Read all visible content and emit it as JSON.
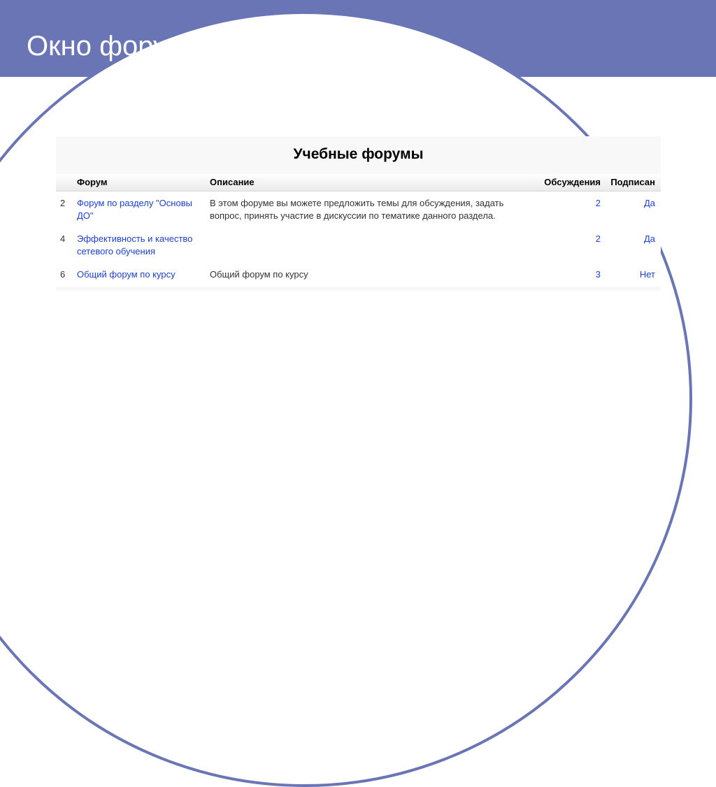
{
  "slide": {
    "title": "Окно форумов на курсе"
  },
  "content": {
    "heading": "Учебные форумы",
    "columns": {
      "n": "",
      "forum": "Форум",
      "desc": "Описание",
      "disc": "Обсуждения",
      "sub": "Подписан"
    },
    "rows": [
      {
        "n": "2",
        "forum": "Форум по разделу \"Основы ДО\"",
        "desc": "В этом форуме вы можете предложить темы для обсуждения, задать вопрос, принять участие в дискуссии по тематике данного раздела.",
        "disc": "2",
        "sub": "Да"
      },
      {
        "n": "4",
        "forum": "Эффективность и качество сетевого обучения",
        "desc": "",
        "disc": "2",
        "sub": "Да"
      },
      {
        "n": "6",
        "forum": "Общий форум по курсу",
        "desc": "Общий форум по курсу",
        "disc": "3",
        "sub": "Нет"
      }
    ]
  }
}
